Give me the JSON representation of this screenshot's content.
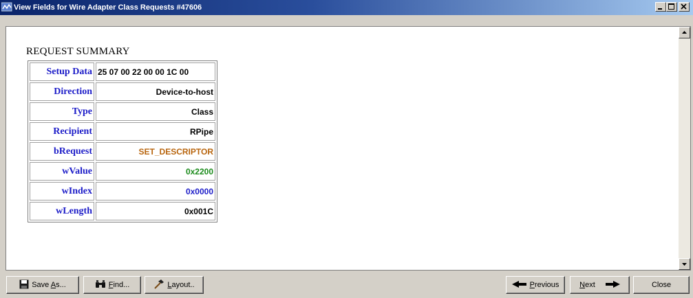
{
  "window": {
    "title": "View Fields for Wire Adapter Class Requests #47606"
  },
  "summary": {
    "heading": "REQUEST SUMMARY",
    "rows": [
      {
        "label": "Setup Data",
        "value": "25 07 00 22 00 00 1C 00",
        "color": "#000000"
      },
      {
        "label": "Direction",
        "value": "Device-to-host",
        "color": "#000000"
      },
      {
        "label": "Type",
        "value": "Class",
        "color": "#000000"
      },
      {
        "label": "Recipient",
        "value": "RPipe",
        "color": "#000000"
      },
      {
        "label": "bRequest",
        "value": "SET_DESCRIPTOR",
        "color": "#b8650e"
      },
      {
        "label": "wValue",
        "value": "0x2200",
        "color": "#1a8a1a"
      },
      {
        "label": "wIndex",
        "value": "0x0000",
        "color": "#1c1cc8"
      },
      {
        "label": "wLength",
        "value": "0x001C",
        "color": "#000000"
      }
    ]
  },
  "buttons": {
    "save_as": {
      "pre": "Save ",
      "key": "A",
      "post": "s..."
    },
    "find": {
      "pre": "",
      "key": "F",
      "post": "ind..."
    },
    "layout": {
      "pre": "",
      "key": "L",
      "post": "ayout.."
    },
    "previous": {
      "pre": "",
      "key": "P",
      "post": "revious"
    },
    "next": {
      "pre": "",
      "key": "N",
      "post": "ext"
    },
    "close": {
      "label": "Close"
    }
  },
  "colors": {
    "title_gradient_start": "#0a246a",
    "title_gradient_end": "#a6caf0",
    "label_blue": "#1c1cc8"
  }
}
